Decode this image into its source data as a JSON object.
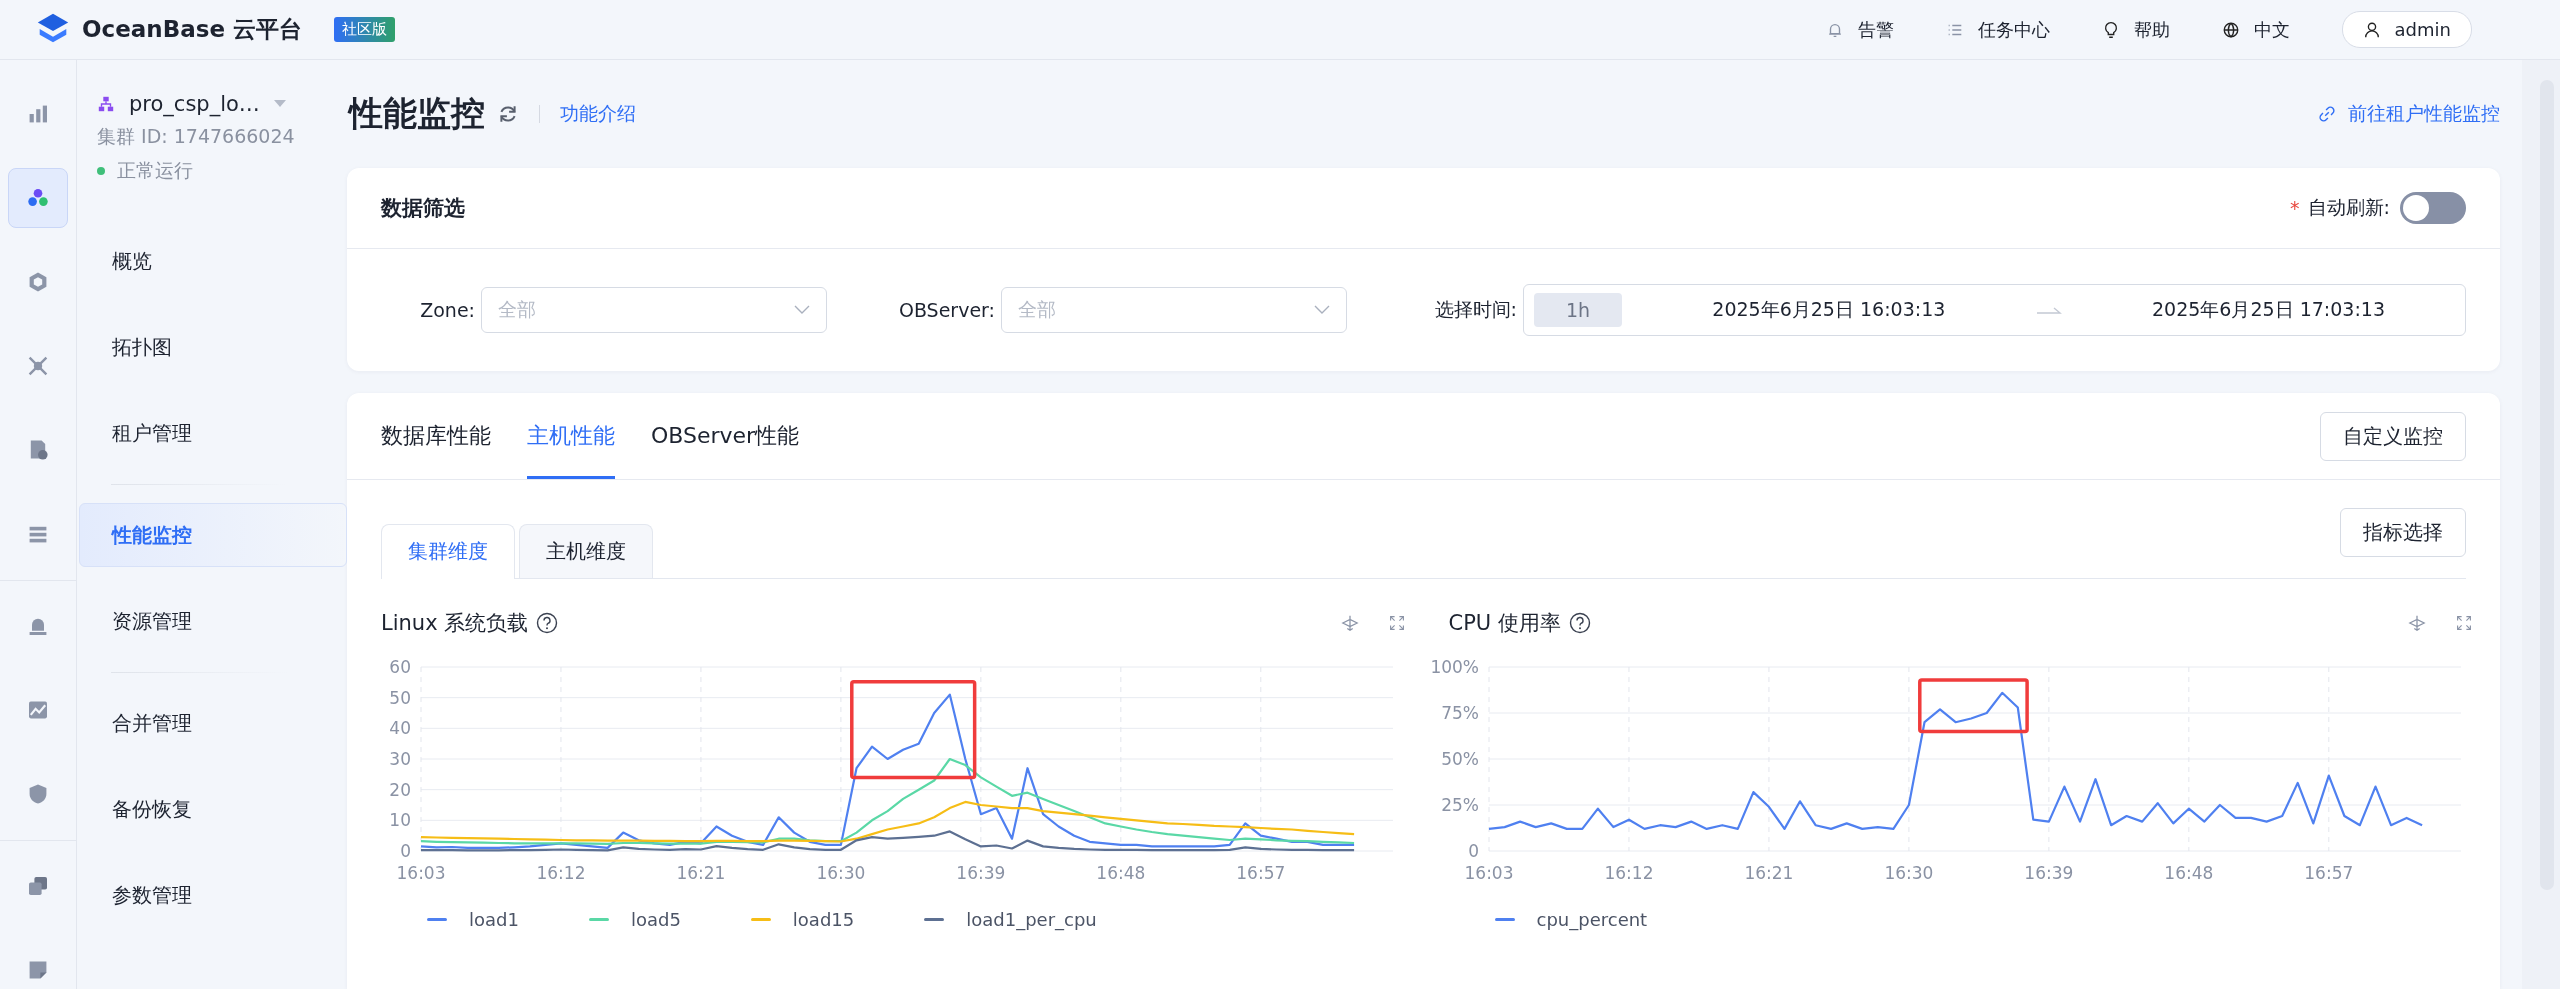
{
  "header": {
    "logo_text": "OceanBase 云平台",
    "edition_badge": "社区版",
    "nav": [
      {
        "label": "告警"
      },
      {
        "label": "任务中心"
      },
      {
        "label": "帮助"
      },
      {
        "label": "中文"
      }
    ],
    "user": "admin"
  },
  "rail_groups": [
    {
      "items": [
        {
          "selected": false
        },
        {
          "selected": true
        },
        {
          "selected": false
        },
        {
          "selected": false
        },
        {
          "selected": false
        },
        {
          "selected": false
        }
      ]
    },
    {
      "items": [
        {
          "selected": false
        },
        {
          "selected": false
        },
        {
          "selected": false
        }
      ]
    },
    {
      "items": [
        {
          "selected": false
        },
        {
          "selected": false
        }
      ]
    }
  ],
  "cluster": {
    "name": "pro_csp_lo…",
    "id_text": "集群 ID: 1747666024",
    "status": "正常运行"
  },
  "menu_groups": [
    {
      "items": [
        {
          "label": "概览",
          "selected": false
        },
        {
          "label": "拓扑图",
          "selected": false
        },
        {
          "label": "租户管理",
          "selected": false
        }
      ]
    },
    {
      "items": [
        {
          "label": "性能监控",
          "selected": true
        },
        {
          "label": "资源管理",
          "selected": false
        }
      ]
    },
    {
      "items": [
        {
          "label": "合并管理",
          "selected": false
        },
        {
          "label": "备份恢复",
          "selected": false
        },
        {
          "label": "参数管理",
          "selected": false
        }
      ]
    }
  ],
  "page": {
    "title": "性能监控",
    "intro_link": "功能介绍",
    "tenant_link": "前往租户性能监控"
  },
  "filter": {
    "title": "数据筛选",
    "required_mark": "*",
    "auto_refresh_label": "自动刷新:",
    "auto_refresh_on": false,
    "zone": {
      "label": "Zone:",
      "placeholder": "全部"
    },
    "observer": {
      "label": "OBServer:",
      "placeholder": "全部"
    },
    "time": {
      "label": "选择时间:",
      "range": "1h",
      "start": "2025年6月25日 16:03:13",
      "end": "2025年6月25日 17:03:13"
    }
  },
  "tabs": [
    {
      "label": "数据库性能",
      "selected": false
    },
    {
      "label": "主机性能",
      "selected": true
    },
    {
      "label": "OBServer性能",
      "selected": false
    }
  ],
  "custom_button": "自定义监控",
  "subtabs": [
    {
      "label": "集群维度",
      "selected": true
    },
    {
      "label": "主机维度",
      "selected": false
    }
  ],
  "metric_button": "指标选择",
  "charts": [
    {
      "title": "Linux 系统负载",
      "highlighted": true,
      "chart_data": {
        "type": "line",
        "grid": true,
        "categories": [
          "16:03",
          null,
          null,
          null,
          null,
          null,
          null,
          null,
          null,
          "16:12",
          null,
          null,
          null,
          null,
          null,
          null,
          null,
          null,
          "16:21",
          null,
          null,
          null,
          null,
          null,
          null,
          null,
          null,
          "16:30",
          null,
          null,
          null,
          null,
          null,
          null,
          null,
          null,
          "16:39",
          null,
          null,
          null,
          null,
          null,
          null,
          null,
          null,
          "16:48",
          null,
          null,
          null,
          null,
          null,
          null,
          null,
          null,
          "16:57",
          null,
          null,
          null,
          null,
          null,
          null
        ],
        "ylim": [
          0,
          60
        ],
        "yticks": [
          0,
          10,
          20,
          30,
          40,
          50,
          60
        ],
        "series": [
          {
            "name": "load1",
            "color": "#4f80f0",
            "values": [
              1.5,
              1.2,
              1.3,
              1,
              1,
              1,
              1.2,
              1.5,
              2,
              2.5,
              2,
              1.5,
              1,
              6,
              3.5,
              2.5,
              2,
              3,
              2.5,
              8,
              5,
              3,
              2,
              11,
              6,
              3,
              2,
              2,
              27,
              34,
              30,
              33,
              35,
              45,
              51,
              30,
              12,
              14,
              4,
              27,
              12,
              8,
              5,
              3,
              2.5,
              2,
              2,
              1.5,
              1.5,
              1.5,
              1.5,
              1.5,
              2,
              9,
              5,
              4,
              3,
              3,
              2,
              2,
              2
            ]
          },
          {
            "name": "load5",
            "color": "#5ad8a6",
            "values": [
              3.2,
              3,
              2.9,
              2.8,
              2.7,
              2.6,
              2.5,
              2.5,
              2.5,
              2.5,
              2.5,
              2.4,
              2.3,
              2.6,
              2.6,
              2.5,
              2.4,
              2.4,
              2.4,
              3,
              3,
              2.9,
              2.8,
              4,
              4,
              3.5,
              3.2,
              3.2,
              6,
              10,
              13,
              17,
              20,
              23,
              30,
              28,
              24,
              21,
              18,
              19,
              17,
              15,
              13,
              11,
              9,
              8,
              7,
              6.2,
              5.5,
              5,
              4.5,
              4,
              3.6,
              4,
              3.8,
              3.5,
              3.3,
              3.2,
              3,
              2.8,
              2.6
            ]
          },
          {
            "name": "load15",
            "color": "#f6bd16",
            "values": [
              4.5,
              4.4,
              4.3,
              4.2,
              4.1,
              4,
              3.9,
              3.8,
              3.7,
              3.6,
              3.5,
              3.5,
              3.4,
              3.4,
              3.4,
              3.3,
              3.3,
              3.2,
              3.2,
              3.3,
              3.3,
              3.2,
              3.2,
              3.4,
              3.4,
              3.3,
              3.2,
              3.1,
              4,
              5.5,
              7,
              8,
              9,
              11,
              14,
              16,
              15,
              14.5,
              14,
              14,
              13,
              12.5,
              12,
              11.5,
              11,
              10.5,
              10,
              9.5,
              9,
              8.8,
              8.5,
              8.2,
              8,
              7.8,
              7.5,
              7.2,
              7,
              6.6,
              6.2,
              5.8,
              5.5
            ]
          },
          {
            "name": "load1_per_cpu",
            "color": "#5d7092",
            "values": [
              0.3,
              0.3,
              0.3,
              0.2,
              0.2,
              0.2,
              0.3,
              0.3,
              0.4,
              0.5,
              0.4,
              0.3,
              0.2,
              1.2,
              0.7,
              0.5,
              0.4,
              0.6,
              0.5,
              1.6,
              1,
              0.6,
              0.4,
              2.2,
              1.2,
              0.6,
              0.4,
              0.4,
              3.5,
              4.5,
              4,
              4.3,
              4.6,
              5,
              6.4,
              3.8,
              1.5,
              1.8,
              0.8,
              3.4,
              1.5,
              1,
              0.7,
              0.5,
              0.4,
              0.4,
              0.4,
              0.3,
              0.3,
              0.3,
              0.3,
              0.3,
              0.4,
              1.2,
              0.7,
              0.5,
              0.4,
              0.4,
              0.3,
              0.3,
              0.3
            ]
          }
        ]
      }
    },
    {
      "title": "CPU 使用率",
      "highlighted": true,
      "chart_data": {
        "type": "line",
        "grid": true,
        "categories": [
          "16:03",
          null,
          null,
          null,
          null,
          null,
          null,
          null,
          null,
          "16:12",
          null,
          null,
          null,
          null,
          null,
          null,
          null,
          null,
          "16:21",
          null,
          null,
          null,
          null,
          null,
          null,
          null,
          null,
          "16:30",
          null,
          null,
          null,
          null,
          null,
          null,
          null,
          null,
          "16:39",
          null,
          null,
          null,
          null,
          null,
          null,
          null,
          null,
          "16:48",
          null,
          null,
          null,
          null,
          null,
          null,
          null,
          null,
          "16:57",
          null,
          null,
          null,
          null,
          null,
          null
        ],
        "ylim": [
          0,
          100
        ],
        "yticks": [
          {
            "value": 0,
            "label": "0"
          },
          {
            "value": 25,
            "label": "25%"
          },
          {
            "value": 50,
            "label": "50%"
          },
          {
            "value": 75,
            "label": "75%"
          },
          {
            "value": 100,
            "label": "100%"
          }
        ],
        "series": [
          {
            "name": "cpu_percent",
            "color": "#4f80f0",
            "values": [
              12,
              13,
              16,
              13,
              15,
              12,
              12,
              23,
              13,
              17,
              12,
              14,
              13,
              16,
              12,
              14,
              12,
              32,
              24,
              12,
              27,
              14,
              12,
              15,
              12,
              13,
              12,
              25,
              70,
              77,
              70,
              72,
              75,
              86,
              78,
              17,
              16,
              35,
              16,
              39,
              14,
              19,
              16,
              26,
              15,
              23,
              16,
              25,
              18,
              18,
              16,
              19,
              37,
              15,
              41,
              19,
              14,
              35,
              14,
              18,
              14
            ]
          }
        ]
      }
    }
  ]
}
